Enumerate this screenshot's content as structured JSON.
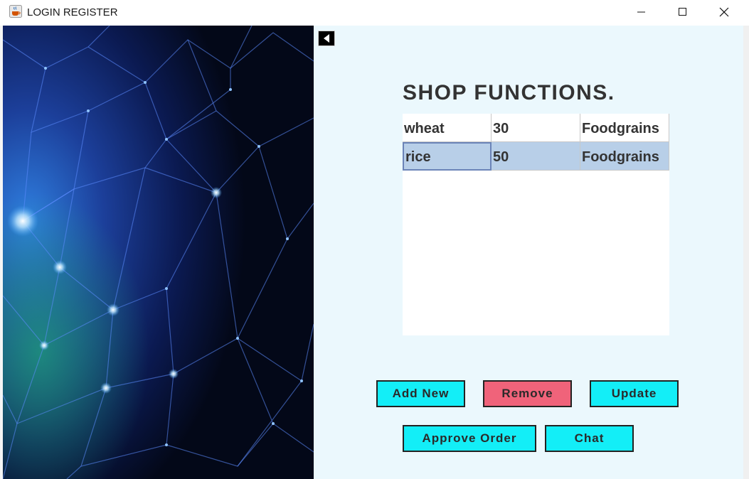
{
  "window": {
    "title": "LOGIN REGISTER",
    "icon": "java-cup-icon"
  },
  "back_button": {
    "icon": "back-arrow-icon"
  },
  "main": {
    "heading": "SHOP FUNCTIONS.",
    "table": {
      "rows": [
        [
          "wheat",
          "30",
          "Foodgrains"
        ],
        [
          "rice",
          "50",
          "Foodgrains"
        ]
      ],
      "selected_row": 1
    }
  },
  "buttons": {
    "add_new": "Add New",
    "remove": "Remove",
    "update": "Update",
    "approve_order": "Approve Order",
    "chat": "Chat"
  },
  "colors": {
    "button_accent": "#13eef7",
    "remove_button": "#f0637a",
    "selected_row": "#b8cfe8",
    "panel_background": "#ebf8fd"
  }
}
